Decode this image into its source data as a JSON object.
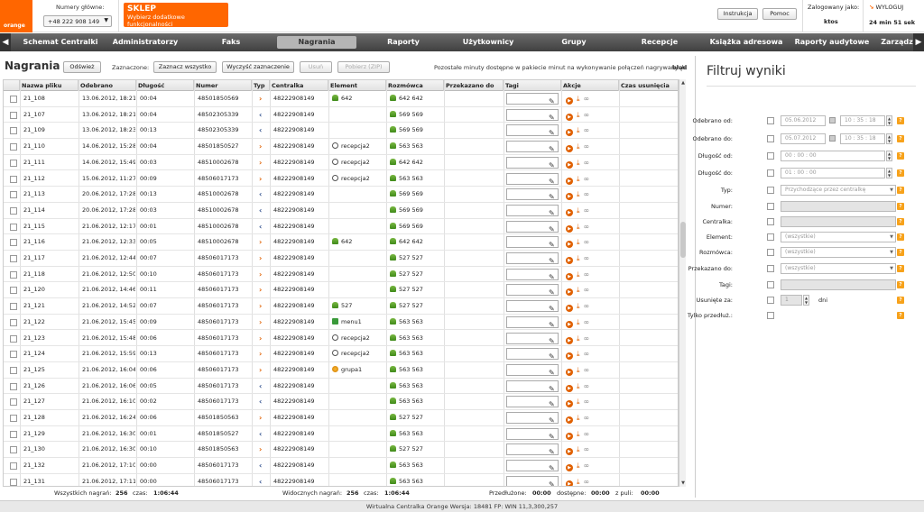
{
  "header": {
    "logo_text": "orange",
    "numbers_label": "Numery główne:",
    "selected_number": "+48 222 908 149",
    "shop_title": "SKLEP",
    "shop_subtitle": "Wybierz dodatkowe funkcjonalności",
    "instruction_label": "Instrukcja",
    "help_label": "Pomoc",
    "logged_label": "Zalogowany jako:",
    "logged_user": "ktos",
    "logout_label": "WYLOGUJ",
    "session_timer": "24 min 51 sek"
  },
  "nav": {
    "items": [
      "Schemat Centralki",
      "Administratorzy",
      "Faks",
      "Nagrania",
      "Raporty",
      "Użytkownicy",
      "Grupy",
      "Recepcje",
      "Książka adresowa",
      "Raporty audytowe",
      "Zarządz"
    ],
    "active": "Nagrania"
  },
  "toolbar": {
    "title": "Nagrania",
    "refresh": "Odśwież",
    "selected_label": "Zaznaczone:",
    "select_all": "Zaznacz wszystko",
    "clear_selection": "Wyczyść zaznaczenie",
    "delete": "Usuń",
    "download_zip": "Pobierz (ZIP)",
    "minutes_info": "Pozostałe minuty dostępne w pakiecie minut na wykonywanie połączeń nagrywanych:",
    "minutes_value": "błąd"
  },
  "table": {
    "columns": [
      "Nazwa pliku",
      "Odebrano",
      "Długość",
      "Numer",
      "Typ",
      "Centralka",
      "Element",
      "Rozmówca",
      "Przekazano do",
      "Tagi",
      "Akcje",
      "Czas usunięcia"
    ],
    "rows": [
      {
        "name": "21_108",
        "date": "13.06.2012, 18:21:3",
        "len": "00:04",
        "number": "48501850569",
        "type": "out",
        "central": "48222908149",
        "el_icon": "user",
        "element": "642",
        "rozm": "642 642"
      },
      {
        "name": "21_107",
        "date": "13.06.2012, 18:21:3",
        "len": "00:04",
        "number": "48502305339",
        "type": "in",
        "central": "48222908149",
        "el_icon": "",
        "element": "",
        "rozm": "569 569"
      },
      {
        "name": "21_109",
        "date": "13.06.2012, 18:23:5",
        "len": "00:13",
        "number": "48502305339",
        "type": "in",
        "central": "48222908149",
        "el_icon": "",
        "element": "",
        "rozm": "569 569"
      },
      {
        "name": "21_110",
        "date": "14.06.2012, 15:28:3",
        "len": "00:04",
        "number": "48501850527",
        "type": "out",
        "central": "48222908149",
        "el_icon": "rec",
        "element": "recepcja2",
        "rozm": "563 563"
      },
      {
        "name": "21_111",
        "date": "14.06.2012, 15:49:5",
        "len": "00:03",
        "number": "48510002678",
        "type": "out",
        "central": "48222908149",
        "el_icon": "rec",
        "element": "recepcja2",
        "rozm": "642 642"
      },
      {
        "name": "21_112",
        "date": "15.06.2012, 11:27:5",
        "len": "00:09",
        "number": "48506017173",
        "type": "out",
        "central": "48222908149",
        "el_icon": "rec",
        "element": "recepcja2",
        "rozm": "563 563"
      },
      {
        "name": "21_113",
        "date": "20.06.2012, 17:28:4",
        "len": "00:13",
        "number": "48510002678",
        "type": "in",
        "central": "48222908149",
        "el_icon": "",
        "element": "",
        "rozm": "569 569"
      },
      {
        "name": "21_114",
        "date": "20.06.2012, 17:28:2",
        "len": "00:03",
        "number": "48510002678",
        "type": "in",
        "central": "48222908149",
        "el_icon": "",
        "element": "",
        "rozm": "569 569"
      },
      {
        "name": "21_115",
        "date": "21.06.2012, 12:17:2",
        "len": "00:01",
        "number": "48510002678",
        "type": "in",
        "central": "48222908149",
        "el_icon": "",
        "element": "",
        "rozm": "569 569"
      },
      {
        "name": "21_116",
        "date": "21.06.2012, 12:33:3",
        "len": "00:05",
        "number": "48510002678",
        "type": "out",
        "central": "48222908149",
        "el_icon": "user",
        "element": "642",
        "rozm": "642 642"
      },
      {
        "name": "21_117",
        "date": "21.06.2012, 12:44:4",
        "len": "00:07",
        "number": "48506017173",
        "type": "out",
        "central": "48222908149",
        "el_icon": "",
        "element": "",
        "rozm": "527 527"
      },
      {
        "name": "21_118",
        "date": "21.06.2012, 12:50:2",
        "len": "00:10",
        "number": "48506017173",
        "type": "out",
        "central": "48222908149",
        "el_icon": "",
        "element": "",
        "rozm": "527 527"
      },
      {
        "name": "21_120",
        "date": "21.06.2012, 14:46:2",
        "len": "00:11",
        "number": "48506017173",
        "type": "out",
        "central": "48222908149",
        "el_icon": "",
        "element": "",
        "rozm": "527 527"
      },
      {
        "name": "21_121",
        "date": "21.06.2012, 14:52:1",
        "len": "00:07",
        "number": "48506017173",
        "type": "out",
        "central": "48222908149",
        "el_icon": "user",
        "element": "527",
        "rozm": "527 527"
      },
      {
        "name": "21_122",
        "date": "21.06.2012, 15:45:3",
        "len": "00:09",
        "number": "48506017173",
        "type": "out",
        "central": "48222908149",
        "el_icon": "menu",
        "element": "menu1",
        "rozm": "563 563"
      },
      {
        "name": "21_123",
        "date": "21.06.2012, 15:48:4",
        "len": "00:06",
        "number": "48506017173",
        "type": "out",
        "central": "48222908149",
        "el_icon": "rec",
        "element": "recepcja2",
        "rozm": "563 563"
      },
      {
        "name": "21_124",
        "date": "21.06.2012, 15:59:4",
        "len": "00:13",
        "number": "48506017173",
        "type": "out",
        "central": "48222908149",
        "el_icon": "rec",
        "element": "recepcja2",
        "rozm": "563 563"
      },
      {
        "name": "21_125",
        "date": "21.06.2012, 16:04:5",
        "len": "00:06",
        "number": "48506017173",
        "type": "out",
        "central": "48222908149",
        "el_icon": "grp",
        "element": "grupa1",
        "rozm": "563 563"
      },
      {
        "name": "21_126",
        "date": "21.06.2012, 16:06:1",
        "len": "00:05",
        "number": "48506017173",
        "type": "in",
        "central": "48222908149",
        "el_icon": "",
        "element": "",
        "rozm": "563 563"
      },
      {
        "name": "21_127",
        "date": "21.06.2012, 16:10:1",
        "len": "00:02",
        "number": "48506017173",
        "type": "in",
        "central": "48222908149",
        "el_icon": "",
        "element": "",
        "rozm": "563 563"
      },
      {
        "name": "21_128",
        "date": "21.06.2012, 16:24:4",
        "len": "00:06",
        "number": "48501850563",
        "type": "out",
        "central": "48222908149",
        "el_icon": "",
        "element": "",
        "rozm": "527 527"
      },
      {
        "name": "21_129",
        "date": "21.06.2012, 16:30:3",
        "len": "00:01",
        "number": "48501850527",
        "type": "in",
        "central": "48222908149",
        "el_icon": "",
        "element": "",
        "rozm": "563 563"
      },
      {
        "name": "21_130",
        "date": "21.06.2012, 16:30:3",
        "len": "00:10",
        "number": "48501850563",
        "type": "out",
        "central": "48222908149",
        "el_icon": "",
        "element": "",
        "rozm": "527 527"
      },
      {
        "name": "21_132",
        "date": "21.06.2012, 17:10:2",
        "len": "00:00",
        "number": "48506017173",
        "type": "in",
        "central": "48222908149",
        "el_icon": "",
        "element": "",
        "rozm": "563 563"
      },
      {
        "name": "21_131",
        "date": "21.06.2012, 17:11:0",
        "len": "00:00",
        "number": "48506017173",
        "type": "in",
        "central": "48222908149",
        "el_icon": "",
        "element": "",
        "rozm": "563 563"
      }
    ]
  },
  "status": {
    "all_label": "Wszystkich nagrań:",
    "all_count": "256",
    "time_label": "czas:",
    "all_time": "1:06:44",
    "visible_label": "Widocznych nagrań:",
    "visible_count": "256",
    "visible_time": "1:06:44",
    "extended_label": "Przedłużone:",
    "extended": "00:00",
    "available_label": "dostępne:",
    "available": "00:00",
    "pool_label": "z puli:",
    "pool": "00:00"
  },
  "footer": {
    "text": "Wirtualna Centralka Orange Wersja: 18481   FP: WIN 11,3,300,257"
  },
  "filter": {
    "title": "Filtruj wyniki",
    "received_from_label": "Odebrano od:",
    "received_from_date": "05.06.2012",
    "received_from_time": "10 : 35 : 18",
    "received_to_label": "Odebrano do:",
    "received_to_date": "05.07.2012",
    "received_to_time": "10 : 35 : 18",
    "len_from_label": "Długość od:",
    "len_from": "00 : 00 : 00",
    "len_to_label": "Długość do:",
    "len_to": "01 : 00 : 00",
    "type_label": "Typ:",
    "type_value": "Przychodzące przez centralkę",
    "number_label": "Numer:",
    "central_label": "Centralka:",
    "element_label": "Element:",
    "element_value": "(wszystkie)",
    "interlocutor_label": "Rozmówca:",
    "interlocutor_value": "(wszystkie)",
    "forwarded_label": "Przekazano do:",
    "forwarded_value": "(wszystkie)",
    "tags_label": "Tagi:",
    "deleted_label": "Usunięte za:",
    "deleted_value": "1",
    "deleted_unit": "dni",
    "extended_only_label": "Tylko przedłuż.:"
  },
  "colors": {
    "brand": "#ff6600",
    "nav_bg": "#505050"
  }
}
